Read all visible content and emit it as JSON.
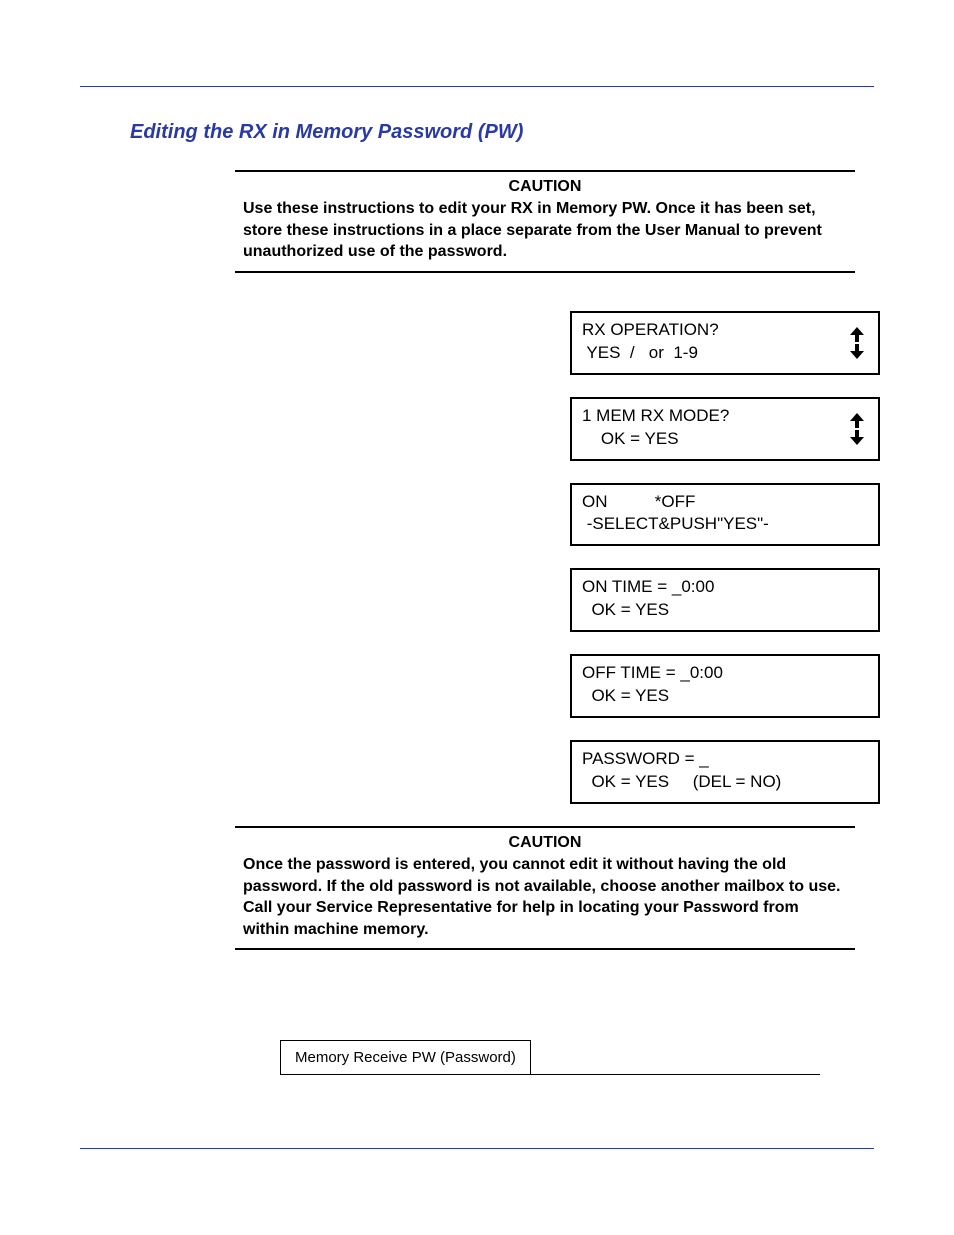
{
  "title": "Editing the RX in Memory Password (PW)",
  "caution1": {
    "heading": "CAUTION",
    "body": "Use these instructions to edit your RX in Memory PW. Once it has been set, store these instructions in a place separate from the User Manual to prevent unauthorized use of the password."
  },
  "displays": [
    {
      "line1": "RX OPERATION?",
      "line2": " YES  /   or  1-9",
      "arrows": true
    },
    {
      "line1": "1 MEM RX MODE?",
      "line2": "    OK = YES",
      "arrows": true
    },
    {
      "line1": "ON          *OFF",
      "line2": " -SELECT&PUSH\"YES\"-",
      "arrows": false
    },
    {
      "line1": "ON TIME = _0:00",
      "line2": "  OK = YES",
      "arrows": false
    },
    {
      "line1": "OFF TIME = _0:00",
      "line2": "  OK = YES",
      "arrows": false
    },
    {
      "line1": "PASSWORD = _",
      "line2": "  OK = YES     (DEL = NO)",
      "arrows": false
    }
  ],
  "caution2": {
    "heading": "CAUTION",
    "body": "Once the password is entered, you cannot edit it without having the old password. If the old password is not available, choose another mailbox to use. Call your Service Representative for help in locating your Password from within machine memory."
  },
  "footer_cell": "Memory Receive PW (Password)"
}
